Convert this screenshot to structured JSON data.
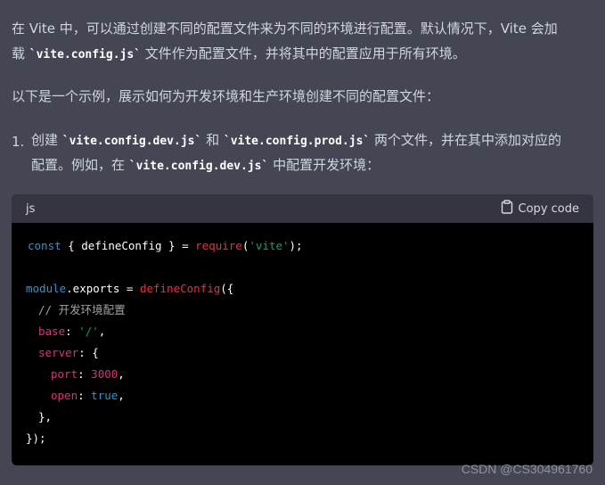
{
  "paragraph1": {
    "line1": "在 Vite 中，可以通过创建不同的配置文件来为不同的环境进行配置。默认情况下，Vite 会加",
    "line2_pre": "载 ",
    "line2_code": "`vite.config.js`",
    "line2_post": " 文件作为配置文件，并将其中的配置应用于所有环境。"
  },
  "paragraph2": "以下是一个示例，展示如何为开发环境和生产环境创建不同的配置文件：",
  "list_item": {
    "number": "1.",
    "line1_pre": "创建 ",
    "line1_code1": "`vite.config.dev.js`",
    "line1_mid": " 和 ",
    "line1_code2": "`vite.config.prod.js`",
    "line1_post": " 两个文件，并在其中添加对应的",
    "line2_pre": "配置。例如，在 ",
    "line2_code": "`vite.config.dev.js`",
    "line2_post": " 中配置开发环境："
  },
  "code_block": {
    "language": "js",
    "copy_label": "Copy code",
    "copy_icon": "clipboard-icon",
    "lines": {
      "l1_kw": "const",
      "l1_a": " { defineConfig } = ",
      "l1_fn": "require",
      "l1_b": "(",
      "l1_str": "'vite'",
      "l1_c": ");",
      "l2_kw": "module",
      "l2_a": ".exports = ",
      "l2_fn": "defineConfig",
      "l2_b": "({",
      "l3_cm": "// 开发环境配置",
      "l4_prop": "base",
      "l4_a": ": ",
      "l4_str": "'/'",
      "l4_b": ",",
      "l5_prop": "server",
      "l5_a": ": {",
      "l6_prop": "port",
      "l6_a": ": ",
      "l6_num": "3000",
      "l6_b": ",",
      "l7_prop": "open",
      "l7_a": ": ",
      "l7_kw": "true",
      "l7_b": ",",
      "l8": "},",
      "l9": "});"
    }
  },
  "watermark": "CSDN @CS304961760",
  "colors": {
    "background": "#444654",
    "code_bg": "#000000",
    "header_bg": "#343541",
    "keyword": "#2e95d3",
    "function": "#f22c3d",
    "string": "#00a67d",
    "number": "#df3079"
  }
}
